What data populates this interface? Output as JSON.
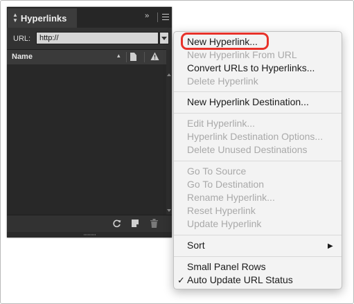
{
  "panel": {
    "title": "Hyperlinks",
    "expand_glyph": "››",
    "url_label": "URL:",
    "url_value": "http://",
    "column_name": "Name",
    "sort_glyph": "▴"
  },
  "context_menu": {
    "items": [
      {
        "label": "New Hyperlink...",
        "enabled": true
      },
      {
        "label": "New Hyperlink From URL",
        "enabled": false
      },
      {
        "label": "Convert URLs to Hyperlinks...",
        "enabled": true
      },
      {
        "label": "Delete Hyperlink",
        "enabled": false
      },
      {
        "label": "New Hyperlink Destination...",
        "enabled": true
      },
      {
        "label": "Edit Hyperlink...",
        "enabled": false
      },
      {
        "label": "Hyperlink Destination Options...",
        "enabled": false
      },
      {
        "label": "Delete Unused Destinations",
        "enabled": false
      },
      {
        "label": "Go To Source",
        "enabled": false
      },
      {
        "label": "Go To Destination",
        "enabled": false
      },
      {
        "label": "Rename Hyperlink...",
        "enabled": false
      },
      {
        "label": "Reset Hyperlink",
        "enabled": false
      },
      {
        "label": "Update Hyperlink",
        "enabled": false
      },
      {
        "label": "Sort",
        "enabled": true,
        "submenu": true
      },
      {
        "label": "Small Panel Rows",
        "enabled": true
      },
      {
        "label": "Auto Update URL Status",
        "enabled": true,
        "checked": true
      }
    ],
    "check_glyph": "✓",
    "submenu_glyph": "▶"
  },
  "colors": {
    "highlight": "#e8322a",
    "panel_bg": "#323232",
    "menu_bg": "#f3f3f3"
  },
  "icons": [
    "tab-collapse-icon",
    "panel-expand-icon",
    "panel-menu-icon",
    "url-dropdown-icon",
    "sort-icon",
    "page-icon",
    "warning-icon",
    "refresh-icon",
    "new-item-icon",
    "trash-icon",
    "check-icon",
    "submenu-arrow-icon"
  ]
}
